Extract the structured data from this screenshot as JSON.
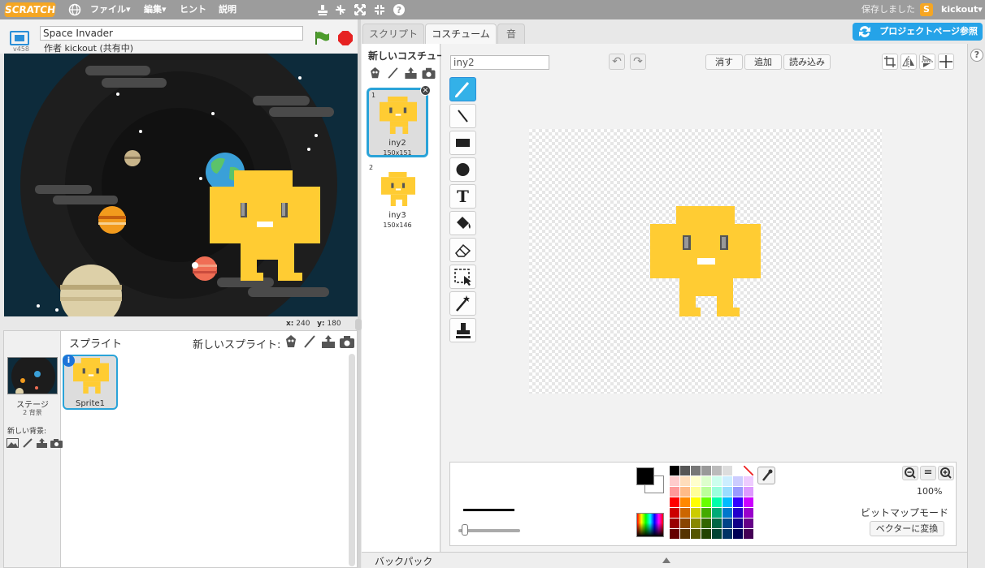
{
  "app": {
    "logo": "SCRATCH",
    "menu": [
      "ファイル▾",
      "編集▾",
      "ヒント",
      "説明"
    ],
    "saved_status": "保存しました",
    "user_badge": "S",
    "user": "kickout▾"
  },
  "project": {
    "version": "v458",
    "title": "Space Invader",
    "author": "作者 kickout (共有中)"
  },
  "stage": {
    "coords_x_label": "x:",
    "coords_x": "240",
    "coords_y_label": "y:",
    "coords_y": "180"
  },
  "sprites_panel": {
    "title": "スプライト",
    "new_sprite_label": "新しいスプライト:",
    "stage_label": "ステージ",
    "stage_backdrops": "2 背景",
    "new_backdrop_label": "新しい背景:",
    "sprites": [
      {
        "name": "Sprite1",
        "info": "i"
      }
    ]
  },
  "tabs": [
    "スクリプト",
    "コスチューム",
    "音"
  ],
  "active_tab": "コスチューム",
  "see_project_page": "プロジェクトページ参照",
  "costumes": {
    "new_costume_label": "新しいコスチューム:",
    "items": [
      {
        "number": "1",
        "name": "iny2",
        "size": "150x151"
      },
      {
        "number": "2",
        "name": "iny3",
        "size": "150x146"
      }
    ],
    "delete_glyph": "×"
  },
  "editor": {
    "costume_name": "iny2",
    "undo": "↶",
    "redo": "↷",
    "clear": "消す",
    "add": "追加",
    "import": "読み込み",
    "zoom_out": "−",
    "zoom_reset": "=",
    "zoom_in": "+",
    "zoom_level": "100%",
    "mode": "ビットマップモード",
    "convert": "ベクターに変換",
    "help": "?",
    "text_tool_glyph": "T",
    "palette": [
      "#000000",
      "#555555",
      "#777777",
      "#999999",
      "#bbbbbb",
      "#dddddd",
      "#ffffff",
      "none",
      "#ffcccc",
      "#ffddbb",
      "#ffffcc",
      "#ddffcc",
      "#ccffee",
      "#cceeff",
      "#ccccff",
      "#eeccff",
      "#ff9999",
      "#ffbb88",
      "#ffff99",
      "#bbff99",
      "#99ffdd",
      "#99ddff",
      "#9999ff",
      "#dd99ff",
      "#ff0000",
      "#ff8800",
      "#ffff00",
      "#66ff00",
      "#00ffaa",
      "#00bbff",
      "#3300ff",
      "#cc00ff",
      "#cc0000",
      "#cc6600",
      "#cccc00",
      "#44aa00",
      "#00aa77",
      "#0077cc",
      "#2200cc",
      "#9900cc",
      "#990000",
      "#884400",
      "#888800",
      "#336600",
      "#006644",
      "#004488",
      "#110088",
      "#660088",
      "#660000",
      "#553300",
      "#555500",
      "#224400",
      "#004433",
      "#003366",
      "#000055",
      "#440055"
    ],
    "fg_color": "#000000",
    "bg_color": "#ffffff"
  },
  "backpack": "バックパック",
  "colors": {
    "accent": "#2aa3d8",
    "menubar": "#9c9c9c",
    "sprite_yellow": "#ffcc33"
  }
}
